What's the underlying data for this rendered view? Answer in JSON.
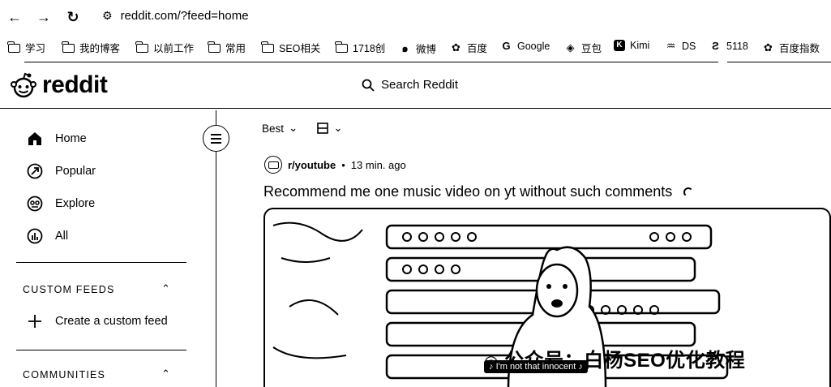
{
  "browser": {
    "url": "reddit.com/?feed=home",
    "bookmarks": [
      "学习",
      "我的博客",
      "以前工作",
      "常用",
      "SEO相关",
      "1718创",
      "微博",
      "百度",
      "Google",
      "豆包",
      "Kimi",
      "DS",
      "5118",
      "百度指数"
    ]
  },
  "header": {
    "logo_text": "reddit",
    "search_placeholder": "Search Reddit"
  },
  "sidebar": {
    "nav": [
      "Home",
      "Popular",
      "Explore",
      "All"
    ],
    "custom_feeds_title": "CUSTOM FEEDS",
    "create_feed_label": "Create a custom feed",
    "communities_title": "COMMUNITIES"
  },
  "feed": {
    "sort_label": "Best",
    "post": {
      "subreddit": "r/youtube",
      "time": "13 min. ago",
      "title": "Recommend me one music video on yt without such comments",
      "caption": "I'm not that innocent",
      "watermark": "公众号：白杨SEO优化教程"
    }
  }
}
